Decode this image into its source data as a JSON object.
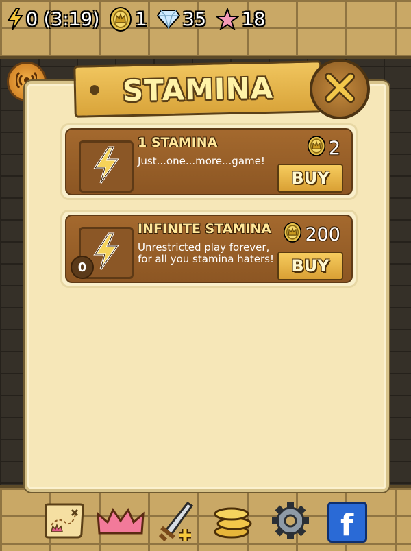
{
  "status_bar": {
    "stamina_value": "0 (3:19)",
    "crowns_value": "1",
    "gems_value": "35",
    "stars_value": "18"
  },
  "dialog": {
    "title": "STAMINA"
  },
  "offers": [
    {
      "name": "1 STAMINA",
      "description": "Just...one...more...game!",
      "price": "2",
      "buy_label": "BUY"
    },
    {
      "name": "INFINITE STAMINA",
      "description": "Unrestricted play forever, for all you stamina haters!",
      "price": "200",
      "buy_label": "BUY",
      "owned_count": "0"
    }
  ],
  "nav": {
    "items": [
      "map-icon",
      "crown-icon",
      "sword-plus-icon",
      "coins-icon",
      "gear-icon",
      "facebook-icon"
    ],
    "facebook_letter": "f"
  },
  "colors": {
    "parchment": "#f6e7b8",
    "wood": "#a4692e",
    "gold": "#f0c55e"
  }
}
